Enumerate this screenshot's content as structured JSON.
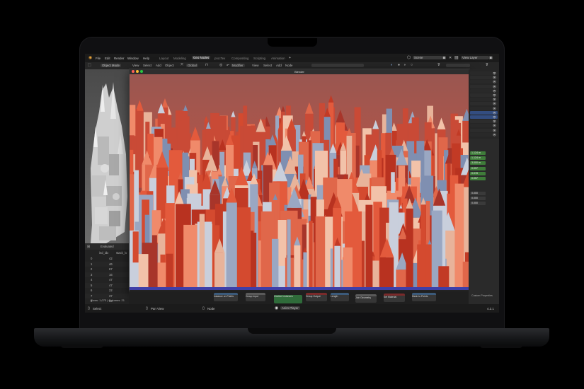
{
  "topbar": {
    "menus": [
      "File",
      "Edit",
      "Render",
      "Window",
      "Help"
    ],
    "workspaces": [
      "Layout",
      "Modeling",
      "Geo Nodes",
      "procTex",
      "Compositing",
      "Scripting",
      "Animation"
    ],
    "active_workspace": "Geo Nodes",
    "add_tab": "+",
    "scene": "Scene",
    "view_layer": "View Layer"
  },
  "toolbar": {
    "mode": "Object Mode",
    "view": "View",
    "select": "Select",
    "add": "Add",
    "object": "Object",
    "orientation": "Global",
    "modifier": "Modifier",
    "view2": "View",
    "select2": "Select",
    "add2": "Add",
    "node": "Node"
  },
  "render_window": {
    "title": "Blender"
  },
  "spreadsheet": {
    "mode": "Evaluated",
    "columns": [
      "ind_idx",
      "stack_lo"
    ],
    "rows": [
      [
        "0",
        "42"
      ],
      [
        "1",
        "46"
      ],
      [
        "2",
        "67"
      ],
      [
        "3",
        "16"
      ],
      [
        "4",
        "47"
      ],
      [
        "5",
        "47"
      ],
      [
        "6",
        "22"
      ],
      [
        "7",
        "37"
      ],
      [
        "8",
        "55"
      ]
    ],
    "footer": "Rows: 1,073 | Columns: 21"
  },
  "properties": {
    "values": [
      "1.124 m",
      "1.124 m",
      "3.000 m",
      "0.097",
      "0.078",
      "0.057",
      "0.000",
      "0.000",
      "0.000"
    ]
  },
  "nodes": {
    "active_label": "Realize Instances",
    "labels": [
      "Instance on Points",
      "Group Input",
      "Group Output",
      "Length",
      "Join Geometry",
      "Set Material",
      "Mesh to Points"
    ]
  },
  "status": {
    "select": "Select",
    "pan_view": "Pan View",
    "node": "Node",
    "center": "Anim Player",
    "version": "4.2.1",
    "custom_props": "Custom Properties"
  },
  "colors": {
    "accent_blue": "#4772b3",
    "active_green": "#3f7d3a",
    "node_red": "#7a2a2a"
  }
}
